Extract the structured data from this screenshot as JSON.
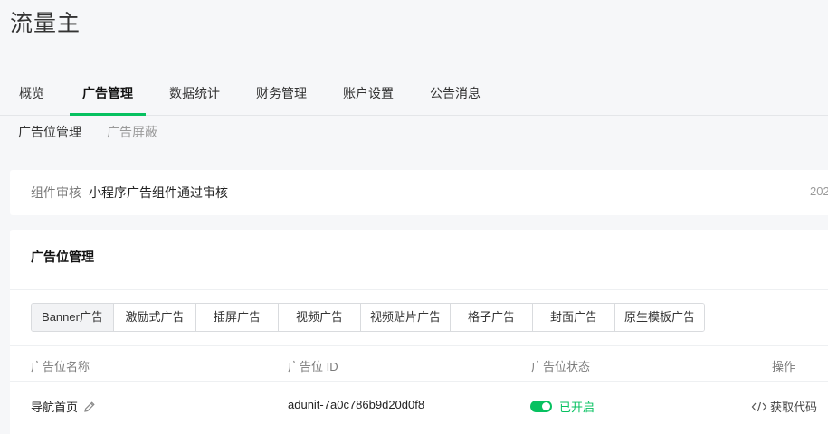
{
  "app": {
    "title": "流量主"
  },
  "main_nav": [
    {
      "label": "概览",
      "active": false
    },
    {
      "label": "广告管理",
      "active": true
    },
    {
      "label": "数据统计",
      "active": false
    },
    {
      "label": "财务管理",
      "active": false
    },
    {
      "label": "账户设置",
      "active": false
    },
    {
      "label": "公告消息",
      "active": false
    }
  ],
  "sub_nav": [
    {
      "label": "广告位管理",
      "active": true
    },
    {
      "label": "广告屏蔽",
      "active": false
    }
  ],
  "notice": {
    "label": "组件审核",
    "text": "小程序广告组件通过审核",
    "date": "202"
  },
  "management": {
    "title": "广告位管理",
    "tabs": [
      {
        "label": "Banner广告",
        "active": true
      },
      {
        "label": "激励式广告"
      },
      {
        "label": "插屏广告"
      },
      {
        "label": "视频广告"
      },
      {
        "label": "视频贴片广告"
      },
      {
        "label": "格子广告"
      },
      {
        "label": "封面广告"
      },
      {
        "label": "原生模板广告"
      }
    ],
    "columns": {
      "name": "广告位名称",
      "id": "广告位 ID",
      "status": "广告位状态",
      "action": "操作"
    },
    "rows": [
      {
        "name": "导航首页",
        "id": "adunit-7a0c786b9d20d0f8",
        "status": "已开启",
        "action": "获取代码"
      }
    ]
  },
  "colors": {
    "accent": "#07c160"
  },
  "icons": {
    "edit": "pencil-icon",
    "code": "code-icon"
  }
}
